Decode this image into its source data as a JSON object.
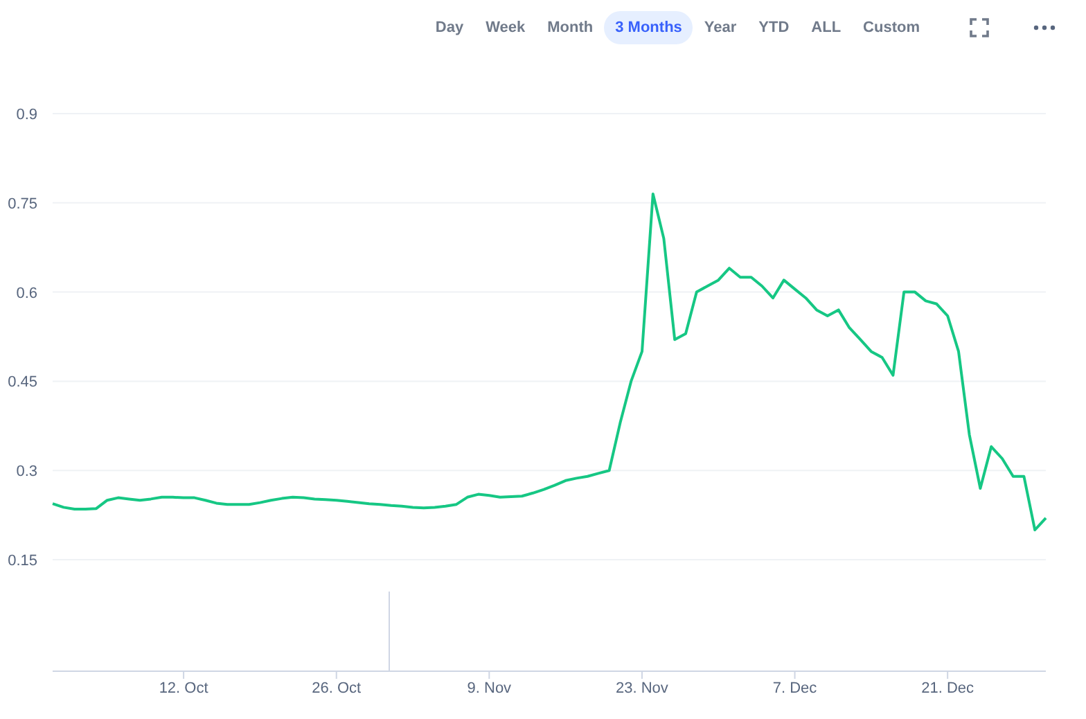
{
  "toolbar": {
    "ranges": [
      {
        "label": "Day",
        "selected": false
      },
      {
        "label": "Week",
        "selected": false
      },
      {
        "label": "Month",
        "selected": false
      },
      {
        "label": "3 Months",
        "selected": true
      },
      {
        "label": "Year",
        "selected": false
      },
      {
        "label": "YTD",
        "selected": false
      },
      {
        "label": "ALL",
        "selected": false
      },
      {
        "label": "Custom",
        "selected": false
      }
    ]
  },
  "chart": {
    "chart_data": {
      "type": "line",
      "grid": true,
      "ylim": [
        0.15,
        0.9
      ],
      "yticks": [
        {
          "value": 0.15,
          "label": "0.15"
        },
        {
          "value": 0.3,
          "label": "0.3"
        },
        {
          "value": 0.45,
          "label": "0.45"
        },
        {
          "value": 0.6,
          "label": "0.6"
        },
        {
          "value": 0.75,
          "label": "0.75"
        },
        {
          "value": 0.9,
          "label": "0.9"
        }
      ],
      "categories": [
        null,
        null,
        null,
        null,
        null,
        null,
        null,
        null,
        null,
        null,
        null,
        null,
        "12. Oct",
        null,
        null,
        null,
        null,
        null,
        null,
        null,
        null,
        null,
        null,
        null,
        null,
        null,
        "26. Oct",
        null,
        null,
        null,
        null,
        null,
        null,
        null,
        null,
        null,
        null,
        null,
        null,
        null,
        "9. Nov",
        null,
        null,
        null,
        null,
        null,
        null,
        null,
        null,
        null,
        null,
        null,
        null,
        null,
        "23. Nov",
        null,
        null,
        null,
        null,
        null,
        null,
        null,
        null,
        null,
        null,
        null,
        null,
        null,
        "7. Dec",
        null,
        null,
        null,
        null,
        null,
        null,
        null,
        null,
        null,
        null,
        null,
        null,
        null,
        "21. Dec",
        null,
        null,
        null,
        null,
        null,
        null,
        null,
        null,
        null
      ],
      "series": [
        {
          "color": "#16c784",
          "values": [
            0.244,
            0.238,
            0.235,
            0.235,
            0.236,
            0.25,
            0.254,
            0.252,
            0.25,
            0.252,
            0.255,
            0.255,
            0.254,
            0.254,
            0.25,
            0.245,
            0.243,
            0.243,
            0.243,
            0.246,
            0.25,
            0.253,
            0.255,
            0.254,
            0.252,
            0.251,
            0.25,
            0.248,
            0.246,
            0.244,
            0.243,
            0.241,
            0.24,
            0.238,
            0.237,
            0.238,
            0.24,
            0.243,
            0.255,
            0.26,
            0.258,
            0.255,
            0.256,
            0.257,
            0.262,
            0.268,
            0.275,
            0.283,
            0.287,
            0.29,
            0.295,
            0.3,
            0.38,
            0.45,
            0.5,
            0.765,
            0.69,
            0.52,
            0.53,
            0.6,
            0.61,
            0.62,
            0.64,
            0.625,
            0.625,
            0.61,
            0.59,
            0.62,
            0.605,
            0.59,
            0.57,
            0.56,
            0.57,
            0.54,
            0.52,
            0.5,
            0.49,
            0.46,
            0.6,
            0.6,
            0.585,
            0.58,
            0.56,
            0.5,
            0.36,
            0.27,
            0.34,
            0.32,
            0.29,
            0.29,
            0.2,
            0.22
          ]
        }
      ]
    }
  }
}
